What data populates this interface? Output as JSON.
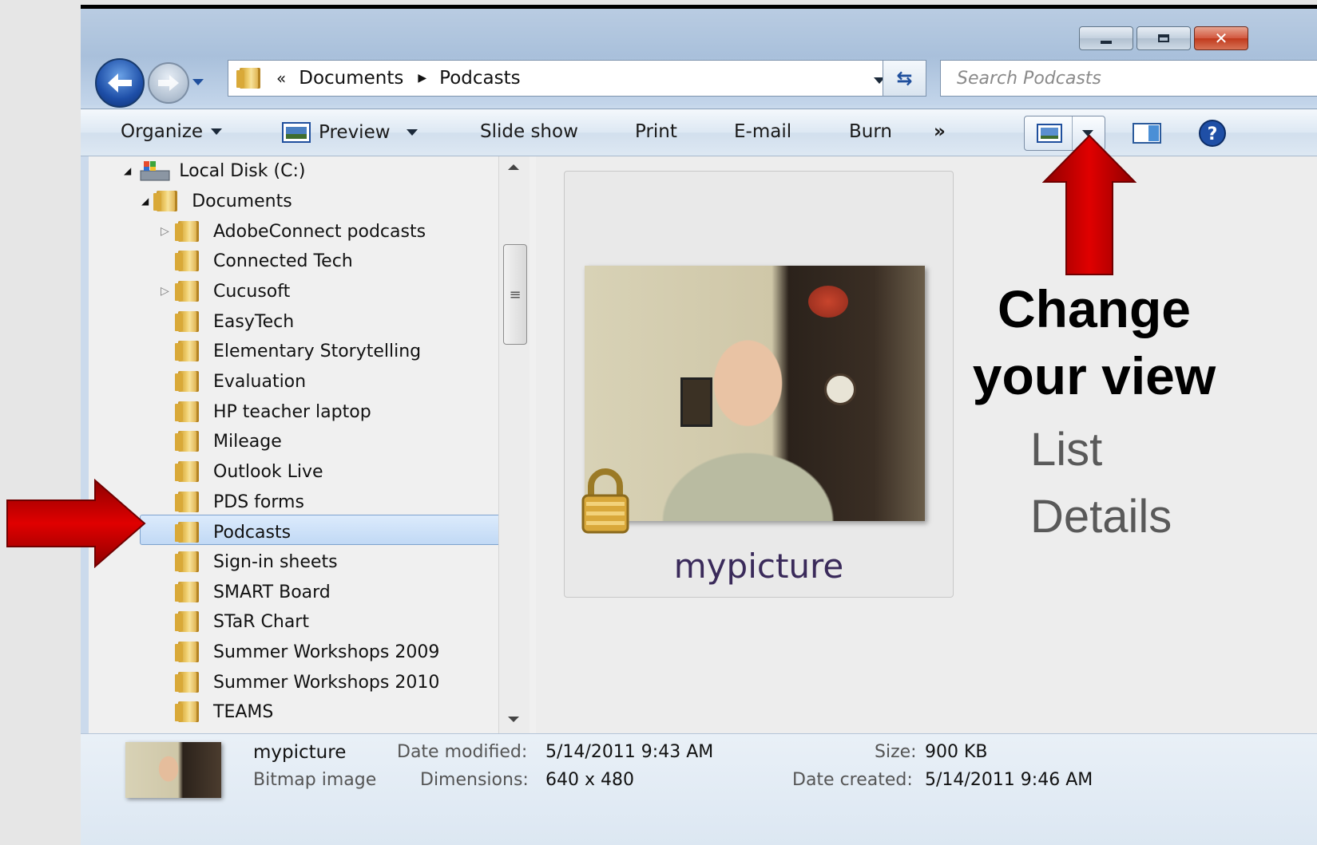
{
  "address": {
    "overflow": "«",
    "segments": [
      "Documents",
      "Podcasts"
    ]
  },
  "search": {
    "placeholder": "Search Podcasts"
  },
  "toolbar": {
    "organize": "Organize",
    "preview": "Preview",
    "slideshow": "Slide show",
    "print": "Print",
    "email": "E-mail",
    "burn": "Burn",
    "more": "»"
  },
  "nav": {
    "drive": "Local Disk (C:)",
    "documents": "Documents",
    "items": [
      "AdobeConnect podcasts",
      "Connected Tech",
      "Cucusoft",
      "EasyTech",
      "Elementary Storytelling",
      "Evaluation",
      "HP teacher laptop",
      "Mileage",
      "Outlook Live",
      "PDS forms",
      "Podcasts",
      "Sign-in sheets",
      "SMART Board",
      "STaR Chart",
      "Summer Workshops 2009",
      "Summer Workshops 2010",
      "TEAMS"
    ],
    "selected": "Podcasts"
  },
  "file": {
    "name": "mypicture"
  },
  "details": {
    "name": "mypicture",
    "type": "Bitmap image",
    "date_modified_label": "Date modified:",
    "date_modified": "5/14/2011 9:43 AM",
    "dimensions_label": "Dimensions:",
    "dimensions": "640 x 480",
    "size_label": "Size:",
    "size": "900 KB",
    "date_created_label": "Date created:",
    "date_created": "5/14/2011 9:46 AM"
  },
  "annotation": {
    "title_line1": "Change",
    "title_line2": "your view",
    "options": [
      "List",
      "Details"
    ]
  },
  "colors": {
    "arrow": "#cc0000",
    "selection": "#c5dbf6"
  }
}
